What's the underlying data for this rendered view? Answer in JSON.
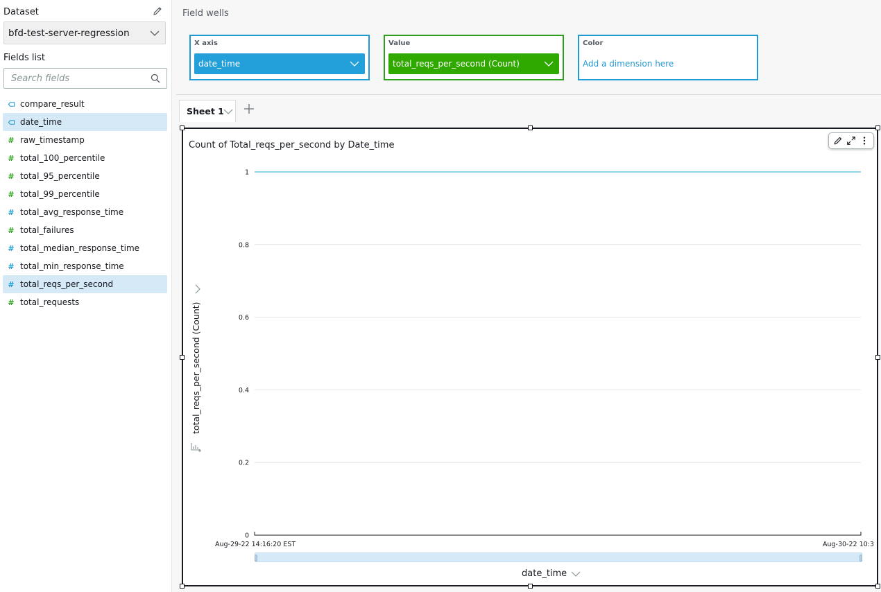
{
  "sidebar": {
    "dataset_label": "Dataset",
    "dataset_value": "bfd-test-server-regression",
    "fields_label": "Fields list",
    "search_placeholder": "Search fields",
    "fields": [
      {
        "name": "compare_result",
        "type": "dimension",
        "icon": "dimension-tag-icon",
        "selected": false
      },
      {
        "name": "date_time",
        "type": "dimension",
        "icon": "dimension-tag-icon",
        "selected": true
      },
      {
        "name": "raw_timestamp",
        "type": "integer",
        "icon": "hash-icon",
        "selected": false
      },
      {
        "name": "total_100_percentile",
        "type": "integer",
        "icon": "hash-icon",
        "selected": false
      },
      {
        "name": "total_95_percentile",
        "type": "integer",
        "icon": "hash-icon",
        "selected": false
      },
      {
        "name": "total_99_percentile",
        "type": "integer",
        "icon": "hash-icon",
        "selected": false
      },
      {
        "name": "total_avg_response_time",
        "type": "decimal",
        "icon": "hash-icon",
        "selected": false
      },
      {
        "name": "total_failures",
        "type": "integer",
        "icon": "hash-icon",
        "selected": false
      },
      {
        "name": "total_median_response_time",
        "type": "decimal",
        "icon": "hash-icon",
        "selected": false
      },
      {
        "name": "total_min_response_time",
        "type": "decimal",
        "icon": "hash-icon",
        "selected": false
      },
      {
        "name": "total_reqs_per_second",
        "type": "decimal",
        "icon": "hash-icon",
        "selected": true
      },
      {
        "name": "total_requests",
        "type": "integer",
        "icon": "hash-icon",
        "selected": false
      }
    ]
  },
  "field_wells": {
    "title": "Field wells",
    "x_axis": {
      "label": "X axis",
      "value": "date_time"
    },
    "value": {
      "label": "Value",
      "value": "total_reqs_per_second (Count)"
    },
    "color": {
      "label": "Color",
      "placeholder": "Add a dimension here"
    }
  },
  "sheets": {
    "tabs": [
      {
        "label": "Sheet 1",
        "active": true
      }
    ],
    "add_label": "+"
  },
  "visual": {
    "title": "Count of Total_reqs_per_second by Date_time",
    "y_axis_title": "total_reqs_per_second (Count)",
    "x_axis_title": "date_time",
    "x_start_label": "Aug-29-22 14:16:20 EST",
    "x_end_label": "Aug-30-22 10:3"
  },
  "colors": {
    "dimension": "#1f9bd4",
    "measure_integer": "#2ca01c",
    "x_well": "#239fd9",
    "value_well": "#2fa800",
    "series_line": "#8fd4ea",
    "selected_bg": "#d5e9f7"
  },
  "chart_data": {
    "type": "line",
    "title": "Count of Total_reqs_per_second by Date_time",
    "xlabel": "date_time",
    "ylabel": "total_reqs_per_second (Count)",
    "x": [
      "Aug-29-22 14:16:20 EST",
      "Aug-30-22 10:3"
    ],
    "series": [
      {
        "name": "total_reqs_per_second (Count)",
        "values": [
          1,
          1
        ]
      }
    ],
    "ylim": [
      0,
      1
    ],
    "yticks": [
      0,
      0.2,
      0.4,
      0.6,
      0.8,
      1
    ],
    "ytick_labels": [
      "0",
      "0.2",
      "0.4",
      "0.6",
      "0.8",
      "1"
    ],
    "grid": true,
    "legend": "none"
  }
}
